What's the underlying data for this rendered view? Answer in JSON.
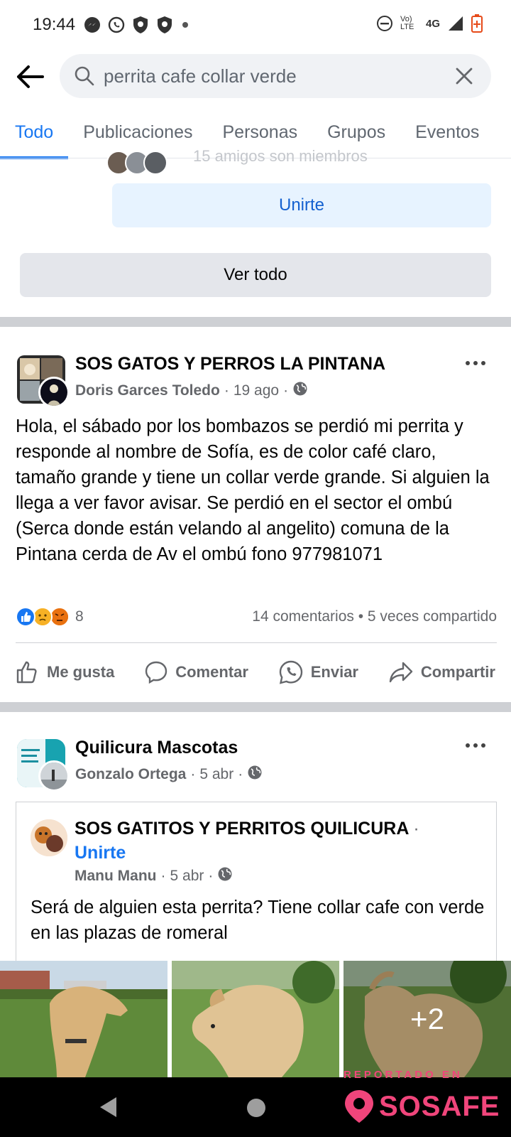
{
  "status_bar": {
    "time": "19:44",
    "network": "4G",
    "lte": "Vo) LTE"
  },
  "search": {
    "query": "perrita cafe collar verde"
  },
  "tabs": [
    {
      "label": "Todo",
      "active": true
    },
    {
      "label": "Publicaciones",
      "active": false
    },
    {
      "label": "Personas",
      "active": false
    },
    {
      "label": "Grupos",
      "active": false
    },
    {
      "label": "Eventos",
      "active": false
    }
  ],
  "group_card": {
    "friends_text": "15 amigos son miembros",
    "join_label": "Unirte",
    "see_all_label": "Ver todo"
  },
  "post1": {
    "group": "SOS  GATOS Y PERROS LA PINTANA",
    "author": "Doris Garces Toledo",
    "date": "19 ago",
    "body": "Hola, el sábado por los bombazos se perdió mi perrita y responde al nombre de Sofía, es de color café claro, tamaño grande y tiene un collar verde grande. Si alguien la llega a ver favor avisar. Se perdió en el sector el ombú (Serca donde están velando al angelito) comuna de la Pintana cerda de Av el ombú fono 977981071",
    "reaction_count": "8",
    "comments": "14 comentarios",
    "shares": "5 veces compartido",
    "actions": {
      "like": "Me gusta",
      "comment": "Comentar",
      "send": "Enviar",
      "share": "Compartir"
    }
  },
  "post2": {
    "group": "Quilicura Mascotas",
    "author": "Gonzalo Ortega",
    "date": "5 abr",
    "shared": {
      "group": "SOS GATITOS Y PERRITOS QUILICURA",
      "join_label": "Unirte",
      "author": "Manu Manu",
      "date": "5 abr",
      "body": "Será de alguien esta perrita? Tiene collar cafe con verde en las plazas de romeral"
    },
    "more_photos": "+2"
  },
  "watermark": {
    "top": "REPORTADO EN",
    "brand": "SOSAFE"
  },
  "colors": {
    "accent": "#1877f2",
    "watermark": "#f0457b"
  }
}
